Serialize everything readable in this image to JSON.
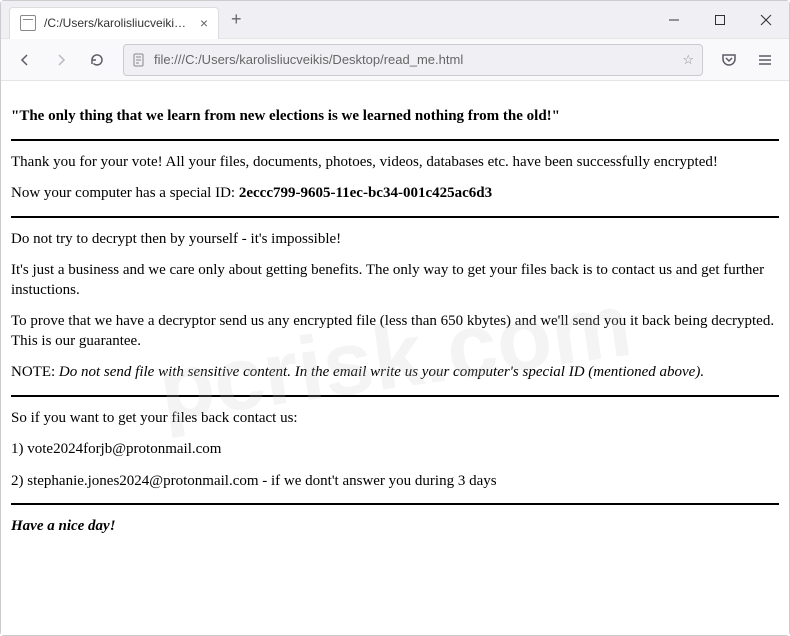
{
  "browser": {
    "tab_title": "/C:/Users/karolisliucveikis/Desktop/",
    "url": "file:///C:/Users/karolisliucveikis/Desktop/read_me.html"
  },
  "content": {
    "heading": "\"The only thing that we learn from new elections is we learned nothing from the old!\"",
    "p1": "Thank you for your vote! All your files, documents, photoes, videos, databases etc. have been successfully encrypted!",
    "p2_prefix": "Now your computer has a special ID: ",
    "special_id": "2eccc799-9605-11ec-bc34-001c425ac6d3",
    "p3": "Do not try to decrypt then by yourself - it's impossible!",
    "p4": "It's just a business and we care only about getting benefits. The only way to get your files back is to contact us and get further instuctions.",
    "p5": "To prove that we have a decryptor send us any encrypted file (less than 650 kbytes) and we'll send you it back being decrypted. This is our guarantee.",
    "note_label": "NOTE: ",
    "note_text": "Do not send file with sensitive content. In the email write us your computer's special ID (mentioned above).",
    "p6": "So if you want to get your files back contact us:",
    "contact1": "1) vote2024forjb@protonmail.com",
    "contact2": "2) stephanie.jones2024@protonmail.com - if we dont't answer you during 3 days",
    "closing": "Have a nice day!"
  },
  "watermark": "pcrisk.com"
}
